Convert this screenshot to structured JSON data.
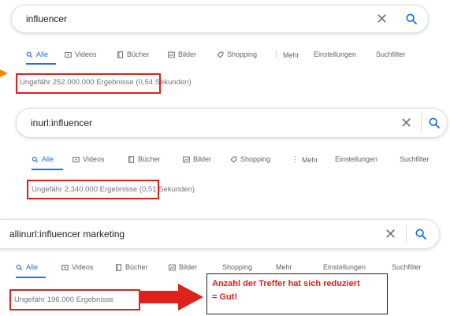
{
  "panels": [
    {
      "query": "influencer",
      "tabs": [
        "Alle",
        "Videos",
        "Bücher",
        "Bilder",
        "Shopping",
        "Mehr",
        "Einstellungen",
        "Suchfilter"
      ],
      "stats_count": "Ungefähr 252.000.000 Ergebnisse",
      "stats_time": "(0,54 Sekunden)"
    },
    {
      "query": "inurl:influencer",
      "tabs": [
        "Alle",
        "Videos",
        "Bücher",
        "Bilder",
        "Shopping",
        "Mehr",
        "Einstellungen",
        "Suchfilter"
      ],
      "stats_count": "Ungefähr 2.340.000 Ergebnisse",
      "stats_time": "(0,51 Sekunden)"
    },
    {
      "query": "allinurl:influencer marketing",
      "tabs": [
        "Alle",
        "Videos",
        "Bücher",
        "Bilder",
        "Shopping",
        "Mehr",
        "Einstellungen",
        "Suchfilter"
      ],
      "stats_count": "Ungefähr 196.000 Ergebnisse",
      "stats_time": ""
    }
  ],
  "callout": {
    "line1": "Anzahl der Treffer hat sich reduziert",
    "line2": "= Gut!"
  },
  "colors": {
    "accent": "#1a73e8",
    "highlight": "#e0201a"
  },
  "icons": {
    "clear": "close-icon",
    "search": "search-icon"
  }
}
